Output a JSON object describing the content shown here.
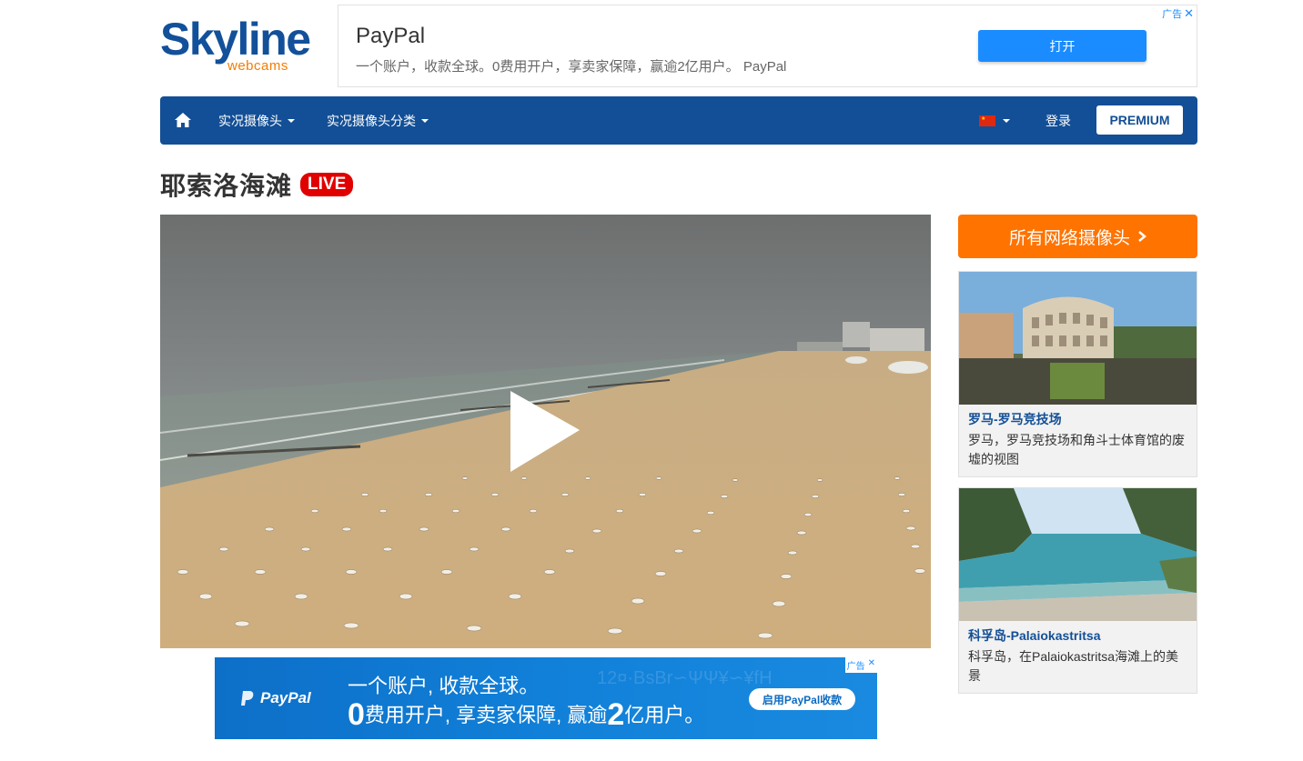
{
  "logo": {
    "main": "Skyline",
    "sub": "webcams"
  },
  "top_ad": {
    "title": "PayPal",
    "description": "一个账户，收款全球。0费用开户，享卖家保障，赢逾2亿用户。 PayPal",
    "button": "打开",
    "badge": "广告",
    "close": "✕"
  },
  "nav": {
    "home_icon": "home-icon",
    "items": [
      {
        "label": "实况摄像头"
      },
      {
        "label": "实况摄像头分类"
      }
    ],
    "language": "CN",
    "login": "登录",
    "premium": "PREMIUM"
  },
  "page": {
    "title": "耶索洛海滩",
    "live_badge": "LIVE"
  },
  "video": {
    "play_icon": "play-icon"
  },
  "bottom_ad": {
    "brand": "PayPal",
    "line1": "一个账户, 收款全球。",
    "line2_a": "0",
    "line2_b": "费用开户, 享卖家保障, 赢逾",
    "line2_c": "2",
    "line2_d": "亿用户。",
    "cta": "启用PayPal收款",
    "badge": "广告"
  },
  "sidebar": {
    "all_button": "所有网络摄像头",
    "cards": [
      {
        "title": "罗马-罗马竞技场",
        "description": "罗马，罗马竞技场和角斗士体育馆的废墟的视图"
      },
      {
        "title": "科孚岛-Palaiokastritsa",
        "description": "科孚岛，在Palaiokastritsa海滩上的美景"
      }
    ]
  },
  "colors": {
    "brand_blue": "#134f96",
    "accent_orange": "#ff7300",
    "live_red": "#e00000",
    "ad_blue": "#1a8cff"
  }
}
